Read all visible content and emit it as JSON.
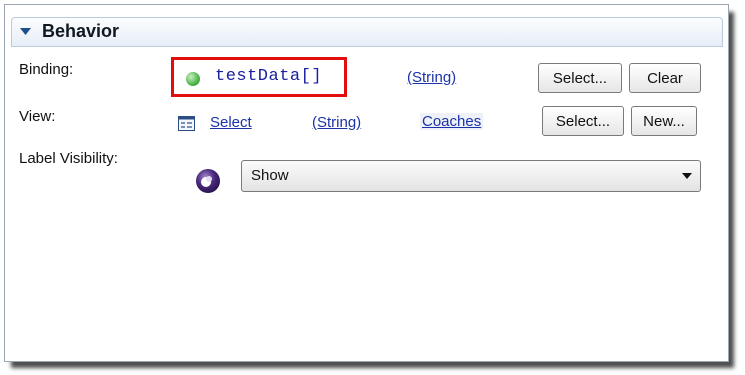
{
  "section": {
    "title": "Behavior"
  },
  "binding": {
    "label": "Binding:",
    "value": "testData[]",
    "type_link": "(String)",
    "select_button": "Select...",
    "clear_button": "Clear"
  },
  "view": {
    "label": "View:",
    "select_link": "Select",
    "type_link": "(String)",
    "coaches_link": "Coaches",
    "select_button": "Select...",
    "new_button": "New..."
  },
  "label_visibility": {
    "label": "Label Visibility:",
    "selected": "Show"
  },
  "colors": {
    "highlight_border": "#e20d0d",
    "link": "#1c33a8",
    "binding_text": "#1a20a0"
  },
  "icons": {
    "collapse": "triangle-down-icon",
    "binding_status": "green-dot-icon",
    "view_select": "form-icon",
    "visibility": "purple-orb-icon",
    "dropdown": "dropdown-arrow-icon"
  }
}
